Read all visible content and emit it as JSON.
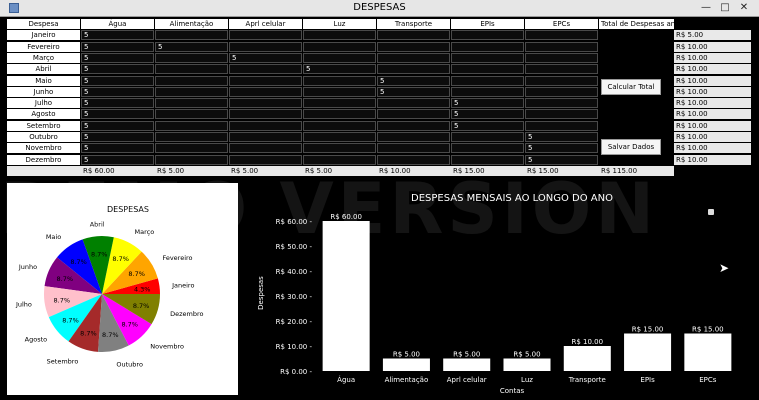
{
  "window": {
    "title": "DESPESAS",
    "min": "—",
    "max": "□",
    "close": "✕"
  },
  "headers": [
    "Despesa",
    "Água",
    "Alimentação",
    "Aprl celular",
    "Luz",
    "Transporte",
    "EPIs",
    "EPCs",
    "Total de Despesas anual"
  ],
  "months": [
    "Janeiro",
    "Fevereiro",
    "Março",
    "Abril",
    "Maio",
    "Junho",
    "Julho",
    "Agosto",
    "Setembro",
    "Outubro",
    "Novembro",
    "Dezembro"
  ],
  "table": [
    [
      "5",
      "5",
      "",
      "",
      "",
      "",
      ""
    ],
    [
      "5",
      "",
      "5",
      "",
      "",
      "",
      ""
    ],
    [
      "5",
      "",
      "",
      "5",
      "",
      "",
      ""
    ],
    [
      "5",
      "",
      "",
      "",
      "5",
      "",
      ""
    ],
    [
      "5",
      "",
      "",
      "",
      "",
      "5",
      ""
    ],
    [
      "5",
      "",
      "",
      "",
      "",
      "5",
      ""
    ],
    [
      "5",
      "",
      "",
      "",
      "",
      "",
      "5"
    ],
    [
      "5",
      "",
      "",
      "",
      "",
      "",
      "5"
    ],
    [
      "5",
      "",
      "",
      "",
      "",
      "",
      "5"
    ],
    [
      "5",
      "",
      "",
      "",
      "",
      "",
      "",
      "5"
    ],
    [
      "5",
      "",
      "",
      "",
      "",
      "",
      "",
      "5"
    ],
    [
      "5",
      "",
      "",
      "",
      "",
      "",
      "",
      "5"
    ]
  ],
  "cells": [
    [
      "5",
      "",
      "",
      "",
      "",
      "",
      ""
    ],
    [
      "5",
      "5",
      "",
      "",
      "",
      "",
      ""
    ],
    [
      "5",
      "",
      "5",
      "",
      "",
      "",
      ""
    ],
    [
      "5",
      "",
      "",
      "5",
      "",
      "",
      ""
    ],
    [
      "5",
      "",
      "",
      "",
      "5",
      "",
      ""
    ],
    [
      "5",
      "",
      "",
      "",
      "5",
      "",
      ""
    ],
    [
      "5",
      "",
      "",
      "",
      "",
      "5",
      ""
    ],
    [
      "5",
      "",
      "",
      "",
      "",
      "5",
      ""
    ],
    [
      "5",
      "",
      "",
      "",
      "",
      "5",
      ""
    ],
    [
      "5",
      "",
      "",
      "",
      "",
      "",
      "5"
    ],
    [
      "5",
      "",
      "",
      "",
      "",
      "",
      "5"
    ],
    [
      "5",
      "",
      "",
      "",
      "",
      "",
      "5"
    ]
  ],
  "column_totals": [
    "R$ 60.00",
    "R$ 5.00",
    "R$ 5.00",
    "R$ 5.00",
    "R$ 10.00",
    "R$ 15.00",
    "R$ 15.00"
  ],
  "grand_total": "R$ 115.00",
  "row_totals": [
    "R$ 5.00",
    "R$ 10.00",
    "R$ 10.00",
    "R$ 10.00",
    "R$ 10.00",
    "R$ 10.00",
    "R$ 10.00",
    "R$ 10.00",
    "R$ 10.00",
    "R$ 10.00",
    "R$ 10.00",
    "R$ 10.00"
  ],
  "buttons": {
    "calcular": "Calcular Total",
    "salvar": "Salvar Dados"
  },
  "watermark": "DEMO VERSION",
  "chart_data": [
    {
      "type": "pie",
      "title": "DESPESAS",
      "categories": [
        "Janeiro",
        "Fevereiro",
        "Março",
        "Abril",
        "Maio",
        "Junho",
        "Julho",
        "Agosto",
        "Setembro",
        "Outubro",
        "Novembro",
        "Dezembro"
      ],
      "values": [
        5,
        10,
        10,
        10,
        10,
        10,
        10,
        10,
        10,
        10,
        10,
        10
      ],
      "labels": [
        "4.3%",
        "8.7%",
        "8.7%",
        "8.7%",
        "8.7%",
        "8.7%",
        "8.7%",
        "8.7%",
        "8.7%",
        "8.7%",
        "8.7%",
        "8.7%"
      ],
      "colors": [
        "#ff0000",
        "#ffa500",
        "#ffff00",
        "#008000",
        "#0000ff",
        "#800080",
        "#ffc0cb",
        "#00ffff",
        "#a52a2a",
        "#808080",
        "#ff00ff",
        "#808000"
      ]
    },
    {
      "type": "bar",
      "title": "DESPESAS MENSAIS AO LONGO DO ANO",
      "categories": [
        "Água",
        "Alimentação",
        "Aprl celular",
        "Luz",
        "Transporte",
        "EPIs",
        "EPCs"
      ],
      "values": [
        60,
        5,
        5,
        5,
        10,
        15,
        15
      ],
      "value_labels": [
        "R$ 60.00",
        "R$ 5.00",
        "R$ 5.00",
        "R$ 5.00",
        "R$ 10.00",
        "R$ 15.00",
        "R$ 15.00"
      ],
      "xlabel": "Contas",
      "ylabel": "Despesas",
      "yticks": [
        "R$ 0.00",
        "R$ 10.00",
        "R$ 20.00",
        "R$ 30.00",
        "R$ 40.00",
        "R$ 50.00",
        "R$ 60.00"
      ],
      "ylim": [
        0,
        60
      ],
      "bar_color": "#ffffff",
      "background": "#000000"
    }
  ]
}
